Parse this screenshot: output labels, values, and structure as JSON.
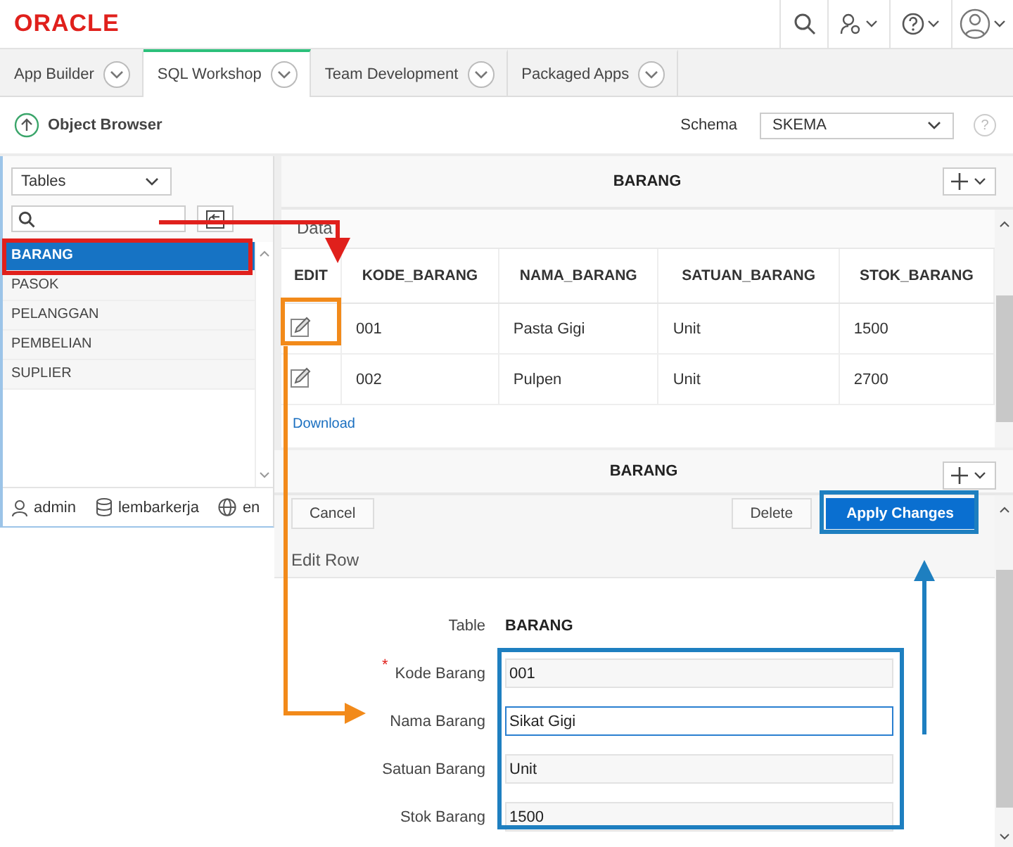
{
  "header": {
    "logo": "ORACLE"
  },
  "tabs": [
    {
      "label": "App Builder",
      "selected": false
    },
    {
      "label": "SQL Workshop",
      "selected": true
    },
    {
      "label": "Team Development",
      "selected": false
    },
    {
      "label": "Packaged Apps",
      "selected": false
    }
  ],
  "page": {
    "title": "Object Browser",
    "schema_label": "Schema",
    "schema_value": "SKEMA",
    "help": "?"
  },
  "sidebar": {
    "filter": "Tables",
    "items": [
      {
        "label": "BARANG",
        "selected": true
      },
      {
        "label": "PASOK",
        "selected": false
      },
      {
        "label": "PELANGGAN",
        "selected": false
      },
      {
        "label": "PEMBELIAN",
        "selected": false
      },
      {
        "label": "SUPLIER",
        "selected": false
      }
    ],
    "footer": [
      {
        "kind": "user",
        "label": "admin"
      },
      {
        "kind": "database",
        "label": "lembarkerja"
      },
      {
        "kind": "globe",
        "label": "en"
      }
    ]
  },
  "data_panel": {
    "title": "BARANG",
    "section": "Data",
    "columns": [
      "EDIT",
      "KODE_BARANG",
      "NAMA_BARANG",
      "SATUAN_BARANG",
      "STOK_BARANG"
    ],
    "rows": [
      [
        "",
        "001",
        "Pasta Gigi",
        "Unit",
        "1500"
      ],
      [
        "",
        "002",
        "Pulpen",
        "Unit",
        "2700"
      ]
    ],
    "download": "Download"
  },
  "edit_panel": {
    "title": "BARANG",
    "buttons": [
      {
        "label": "Cancel",
        "kind": "plain"
      },
      {
        "label": "Delete",
        "kind": "plain"
      },
      {
        "label": "Apply Changes",
        "kind": "primary"
      }
    ],
    "section": "Edit Row",
    "table_label": "Table",
    "table_value": "BARANG",
    "fields": [
      {
        "label": "Kode Barang",
        "value": "001",
        "required_mark": "*",
        "focused": false
      },
      {
        "label": "Nama Barang",
        "value": "Sikat Gigi",
        "focused": true
      },
      {
        "label": "Satuan Barang",
        "value": "Unit",
        "focused": false
      },
      {
        "label": "Stok Barang",
        "value": "1500",
        "focused": false
      }
    ]
  }
}
